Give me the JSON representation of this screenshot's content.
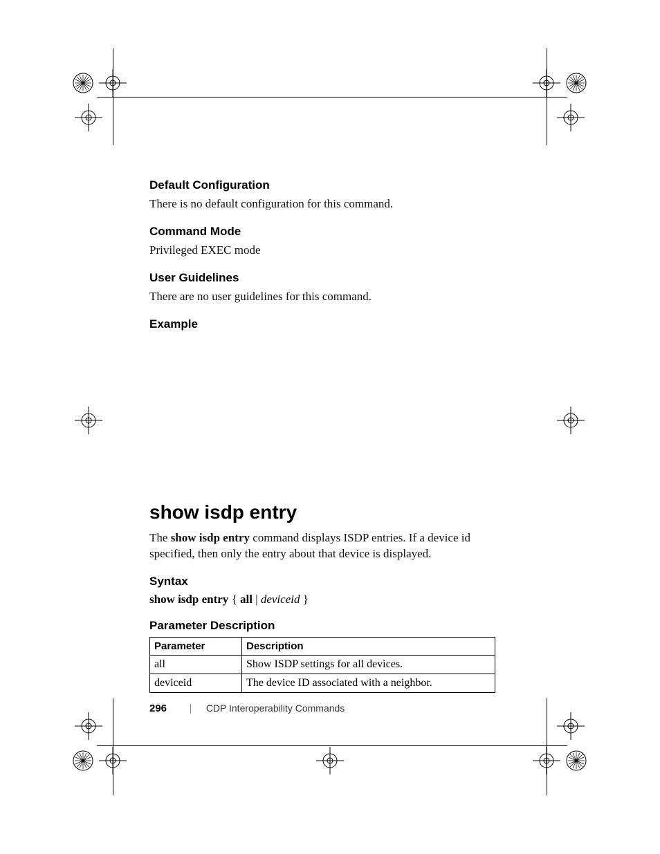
{
  "sections": {
    "default_config": {
      "heading": "Default Configuration",
      "body": "There is no default configuration for this command."
    },
    "command_mode": {
      "heading": "Command Mode",
      "body": "Privileged EXEC mode"
    },
    "user_guidelines": {
      "heading": "User Guidelines",
      "body": "There are no user guidelines for this command."
    },
    "example": {
      "heading": "Example"
    }
  },
  "command": {
    "title": "show isdp entry",
    "intro_prefix": "The ",
    "intro_bold": "show isdp entry",
    "intro_suffix": " command displays ISDP entries. If a device id specified, then only the entry about that device is displayed."
  },
  "syntax": {
    "heading": "Syntax",
    "cmd_bold": "show isdp entry",
    "brace_open": " { ",
    "all_bold": "all",
    "pipe": " | ",
    "deviceid_ital": "deviceid",
    "brace_close": " }"
  },
  "param_desc": {
    "heading": "Parameter Description",
    "columns": {
      "param": "Parameter",
      "desc": "Description"
    },
    "rows": [
      {
        "param": "all",
        "desc": "Show ISDP settings for all devices."
      },
      {
        "param": "deviceid",
        "desc": "The device ID associated with a neighbor."
      }
    ]
  },
  "footer": {
    "page_number": "296",
    "chapter": "CDP Interoperability Commands"
  }
}
